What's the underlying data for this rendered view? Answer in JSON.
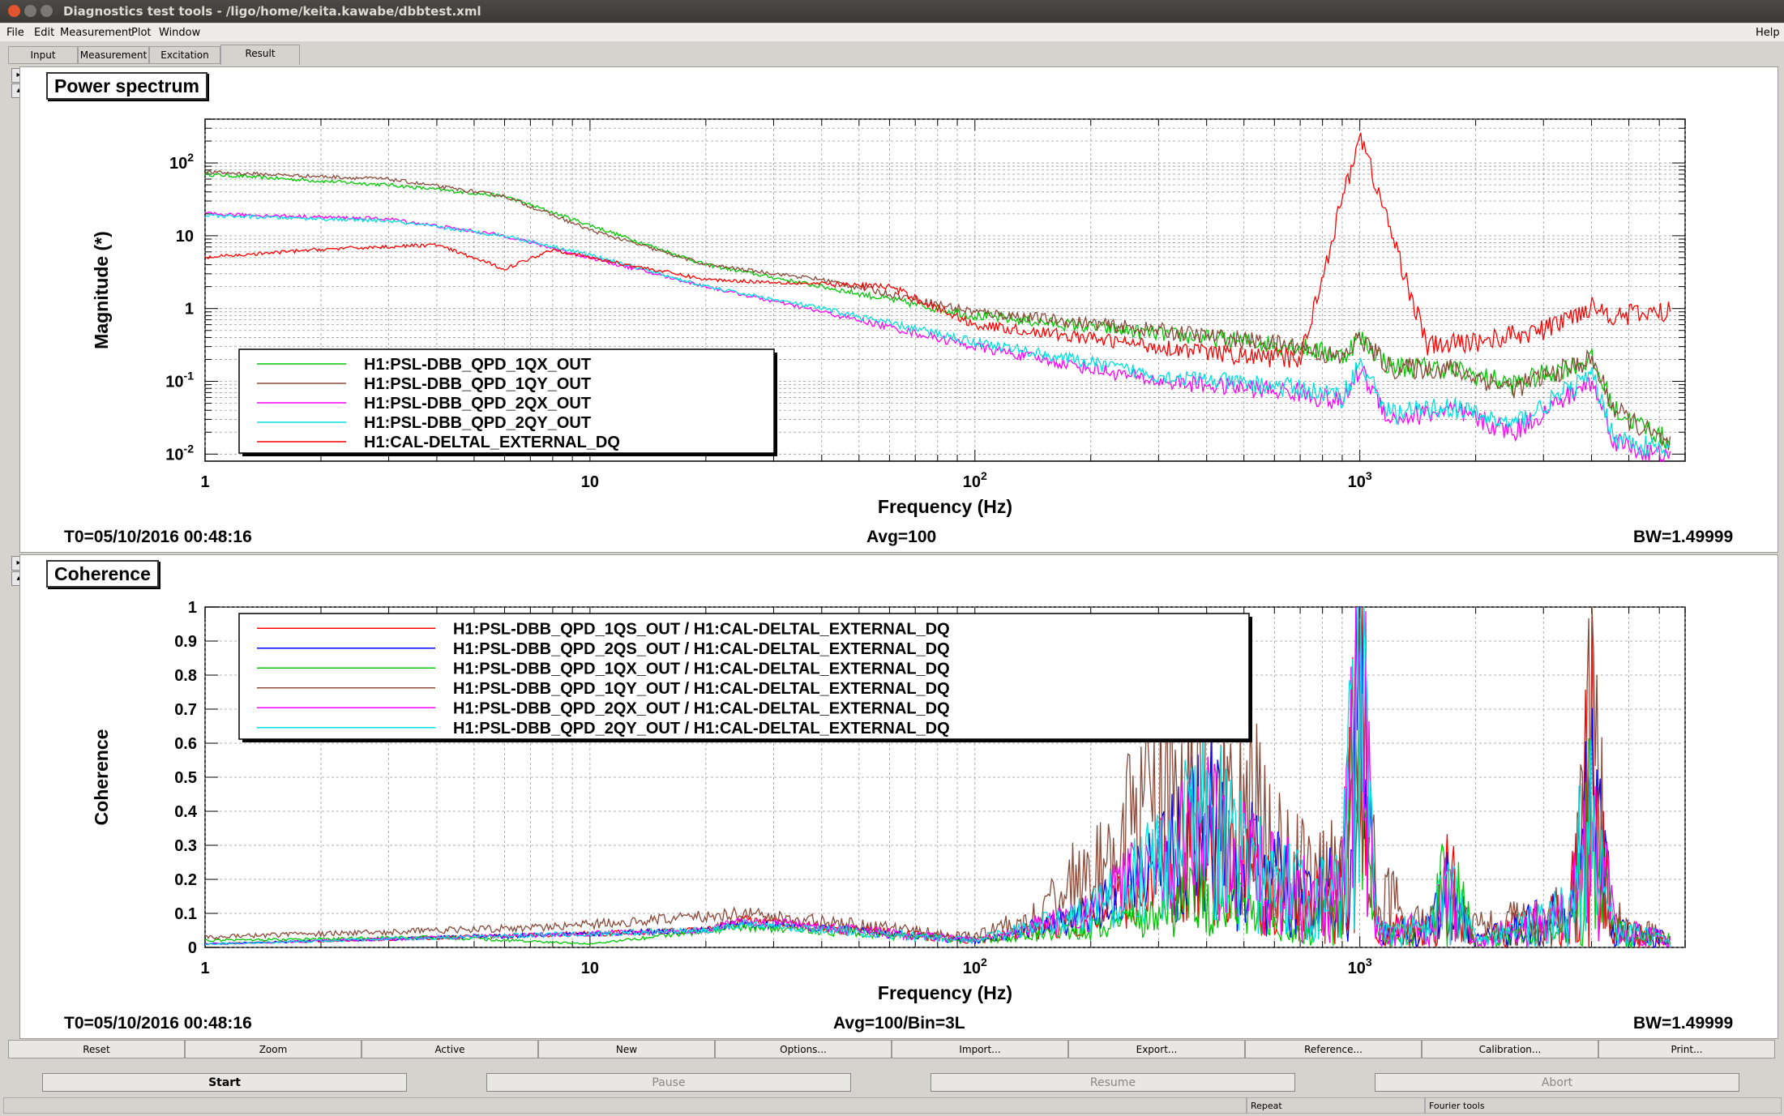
{
  "window": {
    "title": "Diagnostics test tools - /ligo/home/keita.kawabe/dbbtest.xml"
  },
  "menu": {
    "file": "File",
    "edit": "Edit",
    "measurement": "Measurement",
    "plot": "Plot",
    "window": "Window",
    "help": "Help"
  },
  "tabs": [
    "Input",
    "Measurement",
    "Excitation",
    "Result"
  ],
  "colors": {
    "red": "#ff0000",
    "blue": "#0000ff",
    "green": "#00c800",
    "brown": "#8a4a3a",
    "magenta": "#ff00ff",
    "cyan": "#00e0e0"
  },
  "panels": {
    "power": {
      "title": "Power spectrum",
      "t0": "T0=05/10/2016 00:48:16",
      "avg": "Avg=100",
      "bw": "BW=1.49999"
    },
    "coherence": {
      "title": "Coherence",
      "t0": "T0=05/10/2016 00:48:16",
      "avg": "Avg=100/Bin=3L",
      "bw": "BW=1.49999"
    }
  },
  "chart_data": [
    {
      "type": "line",
      "title": "Power spectrum",
      "xlabel": "Frequency (Hz)",
      "ylabel": "Magnitude (*)",
      "xscale": "log",
      "yscale": "log",
      "xlim": [
        1,
        7000
      ],
      "ylim": [
        0.008,
        400
      ],
      "x_ticks": [
        "1",
        "10",
        "10^2",
        "10^3"
      ],
      "y_ticks": [
        "10^-2",
        "10^-1",
        "1",
        "10",
        "10^2"
      ],
      "grid": true,
      "legend_position": "bottom-left",
      "series": [
        {
          "name": "H1:PSL-DBB_QPD_1QX_OUT",
          "color": "green",
          "x": [
            1,
            3,
            6,
            10,
            20,
            40,
            100,
            300,
            700,
            900,
            1000,
            1200,
            1700,
            2500,
            4000,
            4600,
            6500
          ],
          "y": [
            70,
            50,
            35,
            14,
            4,
            2,
            0.8,
            0.45,
            0.3,
            0.22,
            0.4,
            0.16,
            0.15,
            0.09,
            0.2,
            0.04,
            0.014
          ]
        },
        {
          "name": "H1:PSL-DBB_QPD_1QY_OUT",
          "color": "brown",
          "x": [
            1,
            3,
            6,
            10,
            20,
            40,
            100,
            300,
            700,
            900,
            1000,
            1200,
            1700,
            2500,
            4000,
            4600,
            6500
          ],
          "y": [
            75,
            60,
            35,
            12,
            4,
            2.5,
            0.9,
            0.5,
            0.3,
            0.2,
            0.4,
            0.15,
            0.15,
            0.08,
            0.2,
            0.04,
            0.012
          ]
        },
        {
          "name": "H1:PSL-DBB_QPD_2QX_OUT",
          "color": "magenta",
          "x": [
            1,
            3,
            6,
            10,
            20,
            40,
            100,
            300,
            700,
            900,
            1000,
            1200,
            1700,
            2500,
            4000,
            4600,
            6500
          ],
          "y": [
            20,
            17,
            10,
            5,
            2,
            0.9,
            0.3,
            0.1,
            0.07,
            0.05,
            0.15,
            0.03,
            0.04,
            0.02,
            0.1,
            0.015,
            0.008
          ]
        },
        {
          "name": "H1:PSL-DBB_QPD_2QY_OUT",
          "color": "cyan",
          "x": [
            1,
            3,
            6,
            10,
            20,
            40,
            100,
            300,
            700,
            900,
            1000,
            1200,
            1700,
            2500,
            4000,
            4600,
            6500
          ],
          "y": [
            19,
            16,
            10,
            5.5,
            2,
            1,
            0.35,
            0.12,
            0.08,
            0.06,
            0.18,
            0.035,
            0.045,
            0.025,
            0.12,
            0.017,
            0.01
          ]
        },
        {
          "name": "H1:CAL-DELTAL_EXTERNAL_DQ",
          "color": "red",
          "x": [
            1,
            2,
            4,
            6,
            8,
            10,
            20,
            60,
            100,
            300,
            500,
            700,
            1000,
            1500,
            2000,
            3000,
            4000,
            4600,
            6500
          ],
          "y": [
            5,
            6.5,
            7.5,
            3.5,
            6.5,
            5,
            2.5,
            2,
            0.6,
            0.3,
            0.22,
            0.2,
            250,
            0.3,
            0.35,
            0.5,
            1.1,
            0.8,
            0.9
          ]
        }
      ]
    },
    {
      "type": "line",
      "title": "Coherence",
      "xlabel": "Frequency (Hz)",
      "ylabel": "Coherence",
      "xscale": "log",
      "xlim": [
        1,
        7000
      ],
      "ylim": [
        0,
        1
      ],
      "x_ticks": [
        "1",
        "10",
        "10^2",
        "10^3"
      ],
      "y_ticks": [
        "0",
        "0.1",
        "0.2",
        "0.3",
        "0.4",
        "0.5",
        "0.6",
        "0.7",
        "0.8",
        "0.9",
        "1"
      ],
      "grid": true,
      "legend_position": "top-left",
      "series": [
        {
          "name": "H1:PSL-DBB_QPD_1QS_OUT / H1:CAL-DELTAL_EXTERNAL_DQ",
          "color": "red",
          "x": [
            1,
            20,
            25,
            100,
            200,
            300,
            400,
            500,
            700,
            900,
            1000,
            1100,
            1500,
            1700,
            2000,
            3500,
            4000,
            4600,
            6500
          ],
          "y": [
            0.01,
            0.05,
            0.08,
            0.02,
            0.08,
            0.2,
            0.3,
            0.2,
            0.1,
            0.15,
            0.85,
            0.05,
            0.05,
            0.2,
            0.02,
            0.1,
            0.5,
            0.05,
            0.02
          ]
        },
        {
          "name": "H1:PSL-DBB_QPD_2QS_OUT / H1:CAL-DELTAL_EXTERNAL_DQ",
          "color": "blue",
          "x": [
            1,
            20,
            25,
            100,
            200,
            300,
            400,
            500,
            700,
            900,
            1000,
            1100,
            1500,
            1700,
            2000,
            3500,
            4000,
            4600,
            6500
          ],
          "y": [
            0.01,
            0.05,
            0.07,
            0.02,
            0.1,
            0.25,
            0.35,
            0.25,
            0.15,
            0.15,
            0.82,
            0.05,
            0.05,
            0.15,
            0.02,
            0.1,
            0.4,
            0.05,
            0.02
          ]
        },
        {
          "name": "H1:PSL-DBB_QPD_1QX_OUT / H1:CAL-DELTAL_EXTERNAL_DQ",
          "color": "green",
          "x": [
            1,
            4,
            10,
            25,
            100,
            200,
            300,
            400,
            500,
            700,
            900,
            1000,
            1100,
            1500,
            1700,
            2000,
            3500,
            4000,
            4600,
            6500
          ],
          "y": [
            0.02,
            0.03,
            0.01,
            0.06,
            0.02,
            0.05,
            0.1,
            0.15,
            0.1,
            0.05,
            0.1,
            0.6,
            0.03,
            0.05,
            0.2,
            0.02,
            0.05,
            0.35,
            0.05,
            0.02
          ]
        },
        {
          "name": "H1:PSL-DBB_QPD_1QY_OUT / H1:CAL-DELTAL_EXTERNAL_DQ",
          "color": "brown",
          "x": [
            1,
            8,
            25,
            100,
            150,
            200,
            300,
            400,
            500,
            600,
            700,
            900,
            1000,
            1100,
            1500,
            1700,
            2000,
            3500,
            4000,
            4600,
            6500
          ],
          "y": [
            0.03,
            0.06,
            0.1,
            0.03,
            0.1,
            0.25,
            0.45,
            0.45,
            0.4,
            0.3,
            0.2,
            0.2,
            0.7,
            0.15,
            0.05,
            0.15,
            0.05,
            0.1,
            0.55,
            0.08,
            0.02
          ]
        },
        {
          "name": "H1:PSL-DBB_QPD_2QX_OUT / H1:CAL-DELTAL_EXTERNAL_DQ",
          "color": "magenta",
          "x": [
            1,
            20,
            25,
            100,
            200,
            300,
            400,
            500,
            700,
            900,
            1000,
            1100,
            1500,
            1700,
            2000,
            3500,
            4000,
            4600,
            6500
          ],
          "y": [
            0.01,
            0.05,
            0.08,
            0.02,
            0.1,
            0.25,
            0.35,
            0.25,
            0.15,
            0.15,
            0.8,
            0.05,
            0.05,
            0.15,
            0.02,
            0.1,
            0.45,
            0.05,
            0.02
          ]
        },
        {
          "name": "H1:PSL-DBB_QPD_2QY_OUT / H1:CAL-DELTAL_EXTERNAL_DQ",
          "color": "cyan",
          "x": [
            1,
            20,
            25,
            100,
            200,
            300,
            400,
            500,
            700,
            900,
            1000,
            1100,
            1500,
            1700,
            2000,
            3500,
            4000,
            4600,
            6500
          ],
          "y": [
            0.01,
            0.05,
            0.07,
            0.02,
            0.1,
            0.25,
            0.38,
            0.25,
            0.15,
            0.15,
            0.8,
            0.05,
            0.05,
            0.15,
            0.02,
            0.1,
            0.42,
            0.05,
            0.02
          ]
        }
      ]
    }
  ],
  "toolbar": [
    "Reset",
    "Zoom",
    "Active",
    "New",
    "Options...",
    "Import...",
    "Export...",
    "Reference...",
    "Calibration...",
    "Print..."
  ],
  "actions": {
    "start": "Start",
    "pause": "Pause",
    "resume": "Resume",
    "abort": "Abort"
  },
  "status": {
    "repeat": "Repeat",
    "fourier": "Fourier tools"
  }
}
